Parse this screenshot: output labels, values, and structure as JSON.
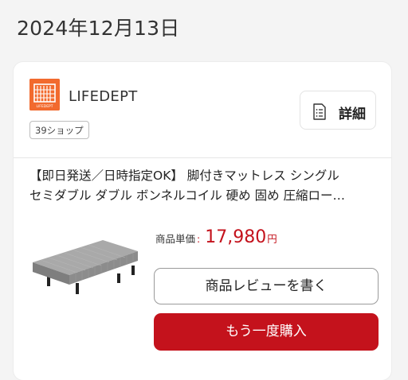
{
  "order_date": "2024年12月13日",
  "shop": {
    "logo_text": "LIFEDEPT",
    "name": "LIFEDEPT",
    "badge": "39ショップ",
    "brand_color": "#f26a2e"
  },
  "detail_button": {
    "label": "詳細",
    "icon": "document-icon"
  },
  "product": {
    "title_line1": "【即日発送／日時指定OK】 脚付きマットレス シングル",
    "title_line2": "セミダブル ダブル ボンネルコイル 硬め 固め 圧縮ロー…",
    "image": "mattress-bed-image"
  },
  "price": {
    "label": "商品単価",
    "colon": ":",
    "value": "17,980",
    "unit": "円",
    "color": "#c4121c"
  },
  "buttons": {
    "review": "商品レビューを書く",
    "rebuy": "もう一度購入",
    "rebuy_color": "#c4121c"
  }
}
